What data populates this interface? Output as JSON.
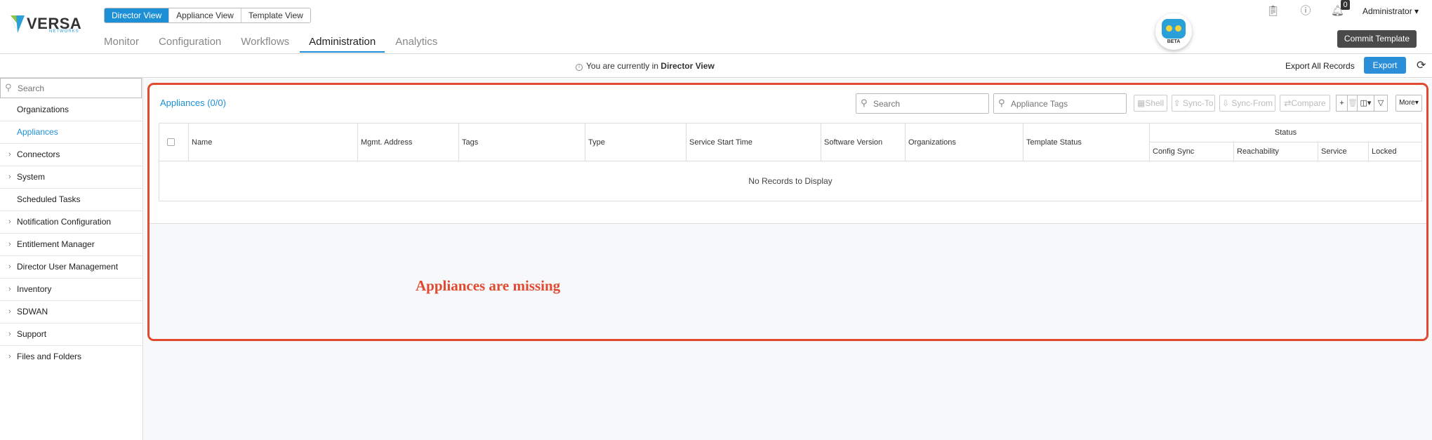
{
  "brand": {
    "name": "VERSA",
    "sub": "NETWORKS"
  },
  "view_switch": [
    {
      "label": "Director View",
      "active": true
    },
    {
      "label": "Appliance View",
      "active": false
    },
    {
      "label": "Template View",
      "active": false
    }
  ],
  "topnav": [
    {
      "label": "Monitor",
      "active": false
    },
    {
      "label": "Configuration",
      "active": false
    },
    {
      "label": "Workflows",
      "active": false
    },
    {
      "label": "Administration",
      "active": true
    },
    {
      "label": "Analytics",
      "active": false
    }
  ],
  "assistant": {
    "badge": "BETA"
  },
  "header": {
    "notification_count": "0",
    "user": "Administrator",
    "commit_label": "Commit Template"
  },
  "infobar": {
    "prefix": "You are currently in",
    "view": "Director View",
    "export_all_label": "Export All Records",
    "export_label": "Export"
  },
  "sidebar": {
    "search_placeholder": "Search",
    "items": [
      {
        "label": "Organizations",
        "expandable": false,
        "active": false
      },
      {
        "label": "Appliances",
        "expandable": false,
        "active": true
      },
      {
        "label": "Connectors",
        "expandable": true,
        "active": false
      },
      {
        "label": "System",
        "expandable": true,
        "active": false
      },
      {
        "label": "Scheduled Tasks",
        "expandable": false,
        "active": false
      },
      {
        "label": "Notification Configuration",
        "expandable": true,
        "active": false
      },
      {
        "label": "Entitlement Manager",
        "expandable": true,
        "active": false
      },
      {
        "label": "Director User Management",
        "expandable": true,
        "active": false
      },
      {
        "label": "Inventory",
        "expandable": true,
        "active": false
      },
      {
        "label": "SDWAN",
        "expandable": true,
        "active": false
      },
      {
        "label": "Support",
        "expandable": true,
        "active": false
      },
      {
        "label": "Files and Folders",
        "expandable": true,
        "active": false
      }
    ]
  },
  "appliances": {
    "title": "Appliances (0/0)",
    "search_placeholder": "Search",
    "tags_placeholder": "Appliance Tags",
    "actions": {
      "shell": "Shell",
      "sync_to": "Sync-To",
      "sync_from": "Sync-From",
      "compare": "Compare",
      "more": "More"
    },
    "columns": {
      "name": "Name",
      "mgmt_address": "Mgmt. Address",
      "tags": "Tags",
      "type": "Type",
      "service_start_time": "Service Start Time",
      "software_version": "Software Version",
      "organizations": "Organizations",
      "template_status": "Template Status",
      "status": "Status",
      "config_sync": "Config Sync",
      "reachability": "Reachability",
      "service": "Service",
      "locked": "Locked"
    },
    "empty_message": "No Records to Display"
  },
  "annotation": {
    "text": "Appliances are missing",
    "color": "#e14a30"
  },
  "colors": {
    "accent": "#1c8fd6",
    "export_button": "#2b8ed9",
    "commit_button": "#4a4a4a",
    "annotation": "#e14a30"
  }
}
